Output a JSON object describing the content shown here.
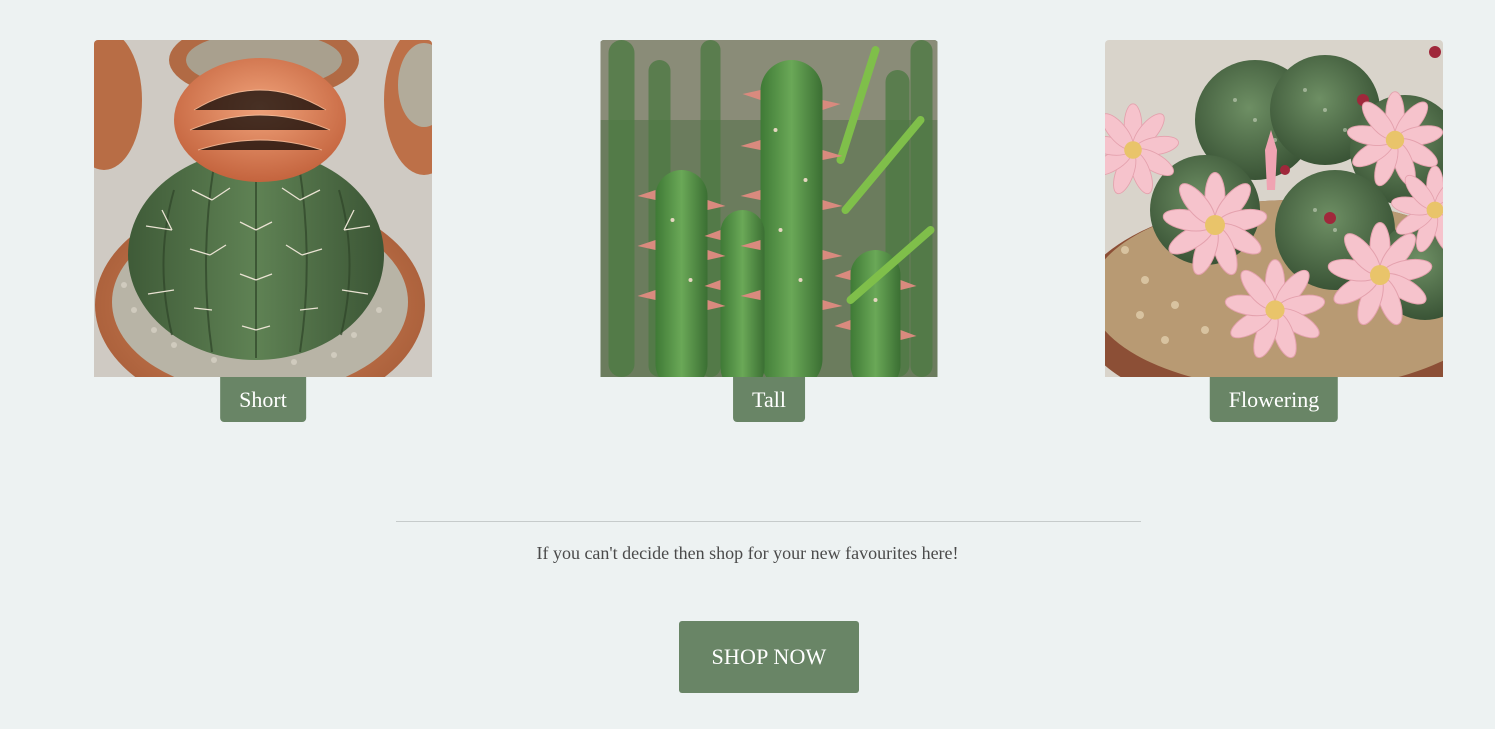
{
  "categories": [
    {
      "label": "Short",
      "photo_icon": "barrel-cactus-photo"
    },
    {
      "label": "Tall",
      "photo_icon": "columnar-cactus-photo"
    },
    {
      "label": "Flowering",
      "photo_icon": "flowering-cactus-photo"
    }
  ],
  "cta": {
    "tagline": "If you can't decide then shop for your new favourites here!",
    "button_label": "SHOP NOW"
  },
  "colors": {
    "background": "#edf2f2",
    "accent": "#698566",
    "button_text": "#ffffff"
  }
}
